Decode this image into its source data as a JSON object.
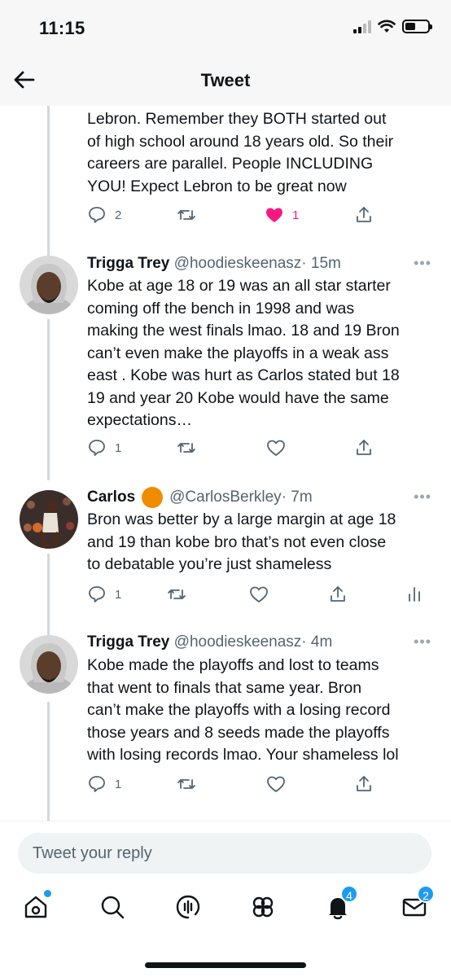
{
  "status_bar": {
    "time": "11:15"
  },
  "header": {
    "title": "Tweet"
  },
  "tweets": [
    {
      "text_lines": [
        "Lebron.  Remember they BOTH started out",
        "of high school around 18 years old. So their",
        "careers are parallel. People INCLUDING",
        "YOU! Expect Lebron to be great now"
      ],
      "reply_count": "2",
      "like_count": "1",
      "liked": true
    },
    {
      "name": "Trigga Trey",
      "handle": "@hoodieskeenasz",
      "time": "· 15m",
      "text_lines": [
        "Kobe at age 18 or 19 was an all star starter",
        "coming off the bench in 1998 and was",
        "making the west finals lmao. 18 and 19 Bron",
        "can’t even make the playoffs in a weak ass",
        "east . Kobe was hurt as Carlos stated but 18",
        "19 and year 20 Kobe would have the same",
        "expectations…"
      ],
      "reply_count": "1"
    },
    {
      "name": "Carlos",
      "handle": "@CarlosBerkley",
      "time": "· 7m",
      "text_lines": [
        "Bron was better by a large margin at age 18",
        "and 19 than kobe bro that’s not even close",
        "to debatable you’re just shameless"
      ],
      "reply_count": "1"
    },
    {
      "name": "Trigga Trey",
      "handle": "@hoodieskeenasz",
      "time": "· 4m",
      "text_lines": [
        "Kobe made the playoffs and lost to teams",
        "that went to finals that same year.  Bron",
        "can’t make the playoffs with a losing record",
        "those years and 8 seeds made the playoffs",
        "with losing records lmao. Your shameless lol"
      ],
      "reply_count": "1"
    }
  ],
  "reply_bar": {
    "placeholder": "Tweet your reply"
  },
  "nav": {
    "items": [
      "home-icon",
      "search-icon",
      "spaces-icon",
      "communities-icon",
      "notifications-icon",
      "messages-icon"
    ],
    "notifications_badge": "4",
    "messages_badge": "2"
  },
  "colors": {
    "like": "#f91880",
    "accent": "#1d9bf0",
    "secondary_text": "#536471"
  }
}
